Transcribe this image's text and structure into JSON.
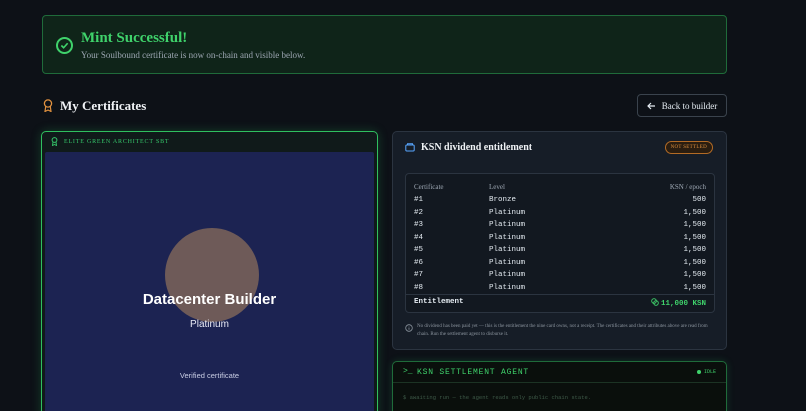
{
  "banner": {
    "title": "Mint Successful!",
    "subtitle": "Your Soulbound certificate is now on-chain and visible below."
  },
  "section": {
    "title": "My Certificates",
    "back_label": "Back to builder"
  },
  "certificate": {
    "header": "ELITE GREEN ARCHITECT SBT",
    "name": "Datacenter Builder",
    "level": "Platinum",
    "verified": "Verified certificate"
  },
  "dividend": {
    "title": "KSN dividend entitlement",
    "badge": "NOT SETTLED",
    "columns": {
      "certificate": "Certificate",
      "level": "Level",
      "ksn": "KSN / epoch"
    },
    "rows": [
      {
        "id": "#1",
        "level": "Bronze",
        "ksn": "500"
      },
      {
        "id": "#2",
        "level": "Platinum",
        "ksn": "1,500"
      },
      {
        "id": "#3",
        "level": "Platinum",
        "ksn": "1,500"
      },
      {
        "id": "#4",
        "level": "Platinum",
        "ksn": "1,500"
      },
      {
        "id": "#5",
        "level": "Platinum",
        "ksn": "1,500"
      },
      {
        "id": "#6",
        "level": "Platinum",
        "ksn": "1,500"
      },
      {
        "id": "#7",
        "level": "Platinum",
        "ksn": "1,500"
      },
      {
        "id": "#8",
        "level": "Platinum",
        "ksn": "1,500"
      }
    ],
    "entitlement_label": "Entitlement",
    "entitlement_value": "11,000 KSN",
    "note": "No dividend has been paid yet — this is the entitlement the nine card owns, not a receipt. The certificates and their attributes above are read from chain. Run the settlement agent to disburse it."
  },
  "agent": {
    "prompt": ">_",
    "title": "KSN SETTLEMENT AGENT",
    "status": "IDLE",
    "log": "$ awaiting run — the agent reads only public chain state."
  },
  "colors": {
    "accent_green": "#3fd26b",
    "badge_orange": "#e0913f",
    "card_blue": "#1c2352"
  }
}
